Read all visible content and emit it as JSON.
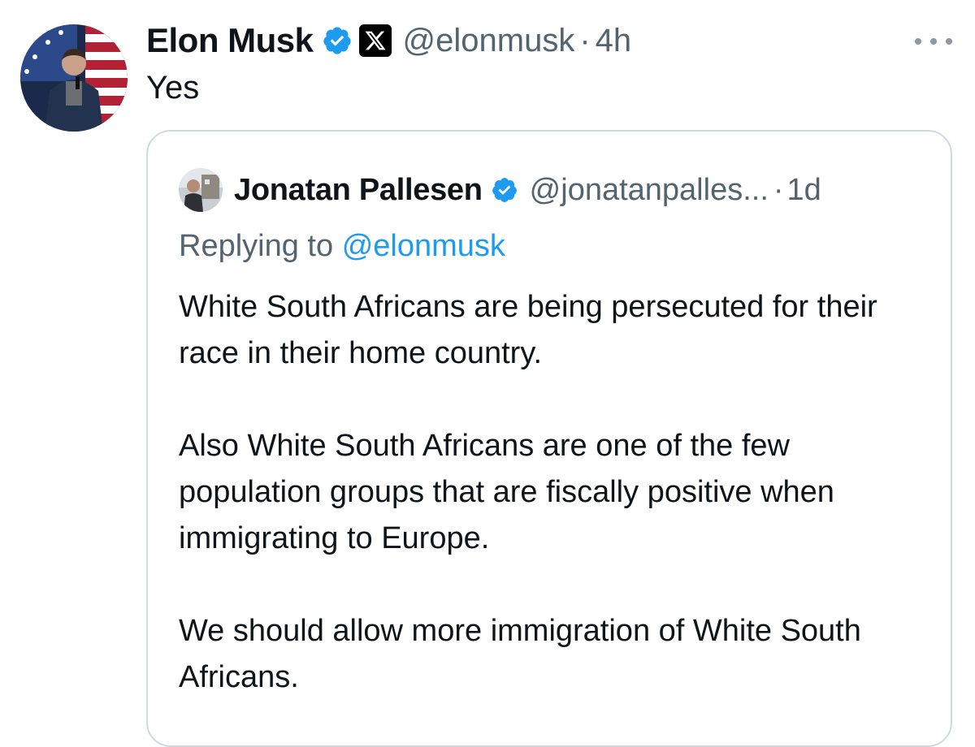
{
  "tweet": {
    "author": {
      "name": "Elon Musk",
      "handle": "@elonmusk",
      "verified_icon": "verified-badge-icon",
      "affiliation_icon": "x-logo-icon"
    },
    "separator": "·",
    "time": "4h",
    "text": "Yes",
    "more_icon": "more-options-icon"
  },
  "quote": {
    "author": {
      "name": "Jonatan Pallesen",
      "handle": "@jonatanpalles...",
      "verified_icon": "verified-badge-icon"
    },
    "separator": "·",
    "time": "1d",
    "replying_prefix": "Replying to",
    "replying_to": "@elonmusk",
    "paragraphs": [
      "White South Africans are being persecuted for their race in their home country.",
      "Also White South Africans are one of the few population groups that are fiscally positive when immigrating to Europe.",
      "We should allow more immigration of White South Africans."
    ]
  },
  "colors": {
    "text_primary": "#0f1419",
    "text_secondary": "#536471",
    "link": "#1d9bf0",
    "verified": "#1d9bf0",
    "border": "#cfd9de"
  }
}
